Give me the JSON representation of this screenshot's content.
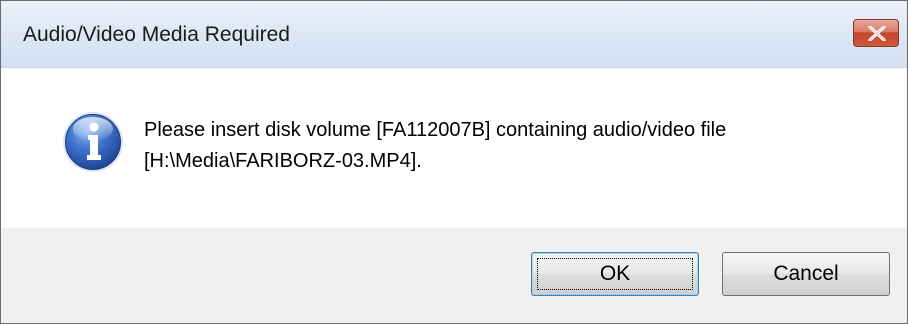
{
  "window": {
    "title": "Audio/Video Media Required",
    "close_icon": "close-x-icon"
  },
  "message": {
    "icon": "information-icon",
    "line1": "Please insert disk volume [FA112007B] containing audio/video file",
    "line2": "[H:\\Media\\FARIBORZ-03.MP4]."
  },
  "buttons": {
    "ok_label": "OK",
    "cancel_label": "Cancel"
  },
  "colors": {
    "close_button": "#c4442c",
    "info_icon": "#2f5fb3",
    "footer_background": "#f0f0f0"
  }
}
